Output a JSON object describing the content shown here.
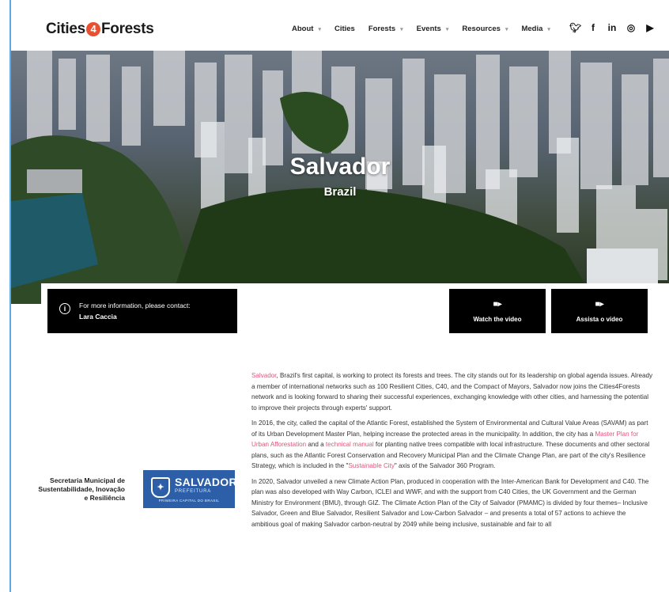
{
  "header": {
    "logo_left": "Cities",
    "logo_mid": "4",
    "logo_right": "Forests",
    "nav": [
      {
        "label": "About",
        "has_menu": true
      },
      {
        "label": "Cities",
        "has_menu": false
      },
      {
        "label": "Forests",
        "has_menu": true
      },
      {
        "label": "Events",
        "has_menu": true
      },
      {
        "label": "Resources",
        "has_menu": true
      },
      {
        "label": "Media",
        "has_menu": true
      }
    ],
    "social_icons": [
      "twitter-icon",
      "facebook-icon",
      "linkedin-icon",
      "instagram-icon",
      "youtube-icon"
    ]
  },
  "hero": {
    "title": "Salvador",
    "subtitle": "Brazil"
  },
  "contact": {
    "line1": "For more information, please contact:",
    "name": "Lara Caccia"
  },
  "videos": [
    {
      "label": "Watch the video"
    },
    {
      "label": "Assista o vídeo"
    }
  ],
  "org": {
    "name": "Secretaria Municipal de Sustentabilidade, Inovação e Resiliência",
    "logo_title": "SALVADOR",
    "logo_sub": "PREFEITURA",
    "logo_tag": "PRIMEIRA CAPITAL DO BRASIL"
  },
  "article": {
    "p1_link": "Salvador",
    "p1": ", Brazil's first capital, is working to protect its forests and trees. The city stands out for its leadership on global agenda issues. Already a member of international networks such as 100 Resilient Cities, C40, and the Compact of Mayors, Salvador now joins the Cities4Forests network and is looking forward to sharing their successful experiences, exchanging knowledge with other cities, and harnessing the potential to improve their projects through experts' support.",
    "p2a": "In 2016, the city, called the capital of the Atlantic Forest, established the System of Environmental and Cultural Value Areas (SAVAM) as part of its Urban Development Master Plan, helping increase the protected areas in the municipality. In addition, the city has a ",
    "p2_link1": "Master Plan for Urban Afforestation",
    "p2b": " and a ",
    "p2_link2": "technical manual",
    "p2c": " for planting native trees compatible with local infrastructure. These documents and other sectoral plans, such as the Atlantic Forest Conservation and Recovery Municipal Plan and the Climate Change Plan, are part of the city's Resilience Strategy, which is included in the \"",
    "p2_link3": "Sustainable City",
    "p2d": "\" axis of the Salvador 360 Program.",
    "p3": "In 2020, Salvador unveiled a new Climate Action Plan, produced in cooperation with the Inter-American Bank for Development and C40. The plan was also developed with Way Carbon, ICLEI and WWF, and with the support from C40 Cities, the UK Government and the German Ministry for Environment (BMU), through GIZ. The Climate Action Plan of the City of Salvador (PMAMC) is divided by four themes– Inclusive Salvador, Green and Blue Salvador, Resilient Salvador and Low-Carbon Salvador – and presents a total of 57 actions to achieve the ambitious goal of making Salvador carbon-neutral by 2049 while being inclusive, sustainable and fair to all"
  },
  "colors": {
    "link": "#e0567a",
    "logo_accent": "#e8502f",
    "org_blue": "#2c5fa8"
  }
}
